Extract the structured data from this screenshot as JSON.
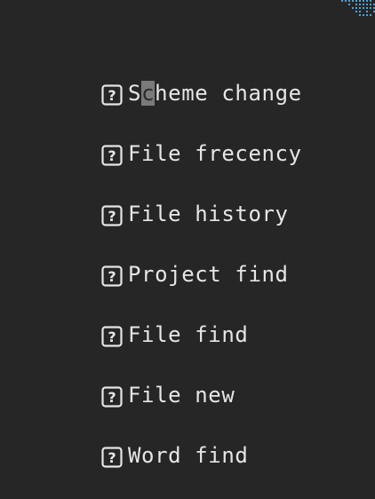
{
  "colors": {
    "background": "#262626",
    "text": "#e6e6e6",
    "cursor": "#7a7a7a",
    "accent_dots": "#4aa3d8"
  },
  "menu": {
    "items": [
      {
        "label": "Scheme change",
        "icon": "unknown-glyph-icon"
      },
      {
        "label": "File frecency",
        "icon": "unknown-glyph-icon"
      },
      {
        "label": "File history",
        "icon": "unknown-glyph-icon"
      },
      {
        "label": "Project find",
        "icon": "unknown-glyph-icon"
      },
      {
        "label": "File find",
        "icon": "unknown-glyph-icon"
      },
      {
        "label": "File new",
        "icon": "unknown-glyph-icon"
      },
      {
        "label": "Word find",
        "icon": "unknown-glyph-icon"
      }
    ]
  }
}
